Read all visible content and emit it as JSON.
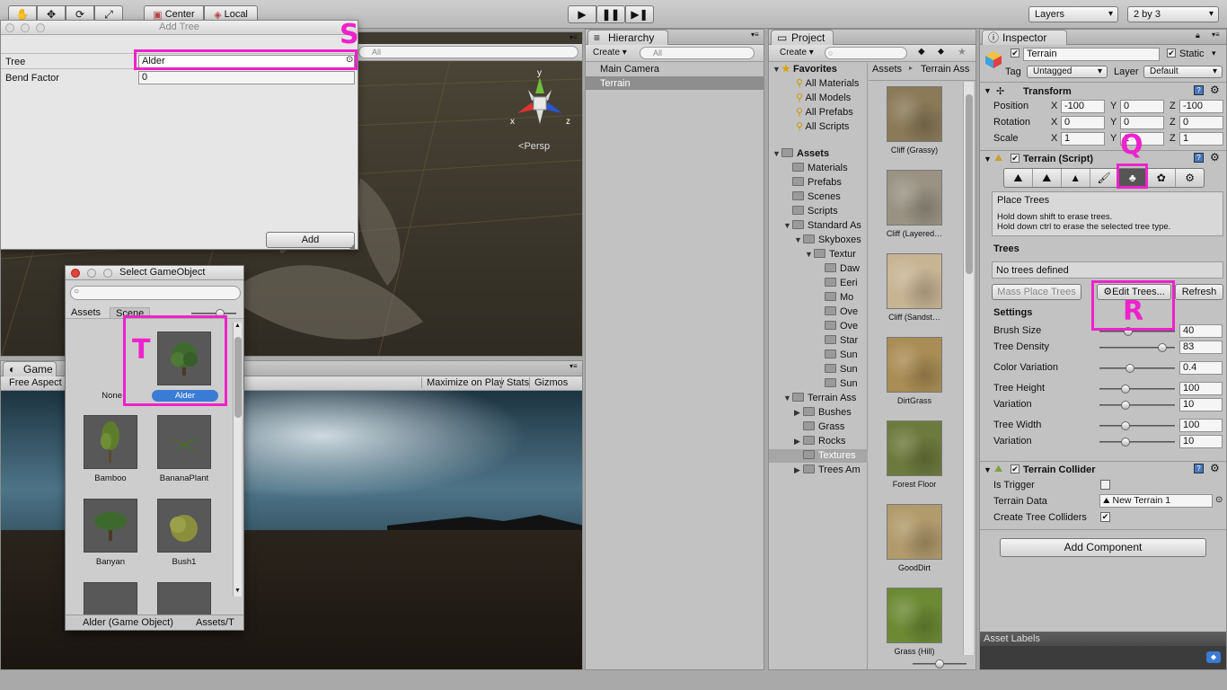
{
  "toolbar": {
    "center_label": "Center",
    "local_label": "Local",
    "layers_label": "Layers",
    "layout_label": "2 by 3"
  },
  "add_tree": {
    "title": "Add Tree",
    "tree_label": "Tree",
    "tree_value": "Alder",
    "bend_label": "Bend Factor",
    "bend_value": "0",
    "add_button": "Add"
  },
  "scene": {
    "search_placeholder": "All",
    "gizmo_y": "y",
    "gizmo_x": "x",
    "gizmo_z": "z",
    "persp_label": "Persp"
  },
  "game": {
    "tab_label": "Game",
    "aspect_label": "Free Aspect",
    "maximize_label": "Maximize on Play",
    "stats_label": "Stats",
    "gizmos_label": "Gizmos"
  },
  "select_go": {
    "title": "Select GameObject",
    "tab_assets": "Assets",
    "tab_scene": "Scene",
    "items": [
      {
        "label": "None"
      },
      {
        "label": "Alder"
      },
      {
        "label": "Bamboo"
      },
      {
        "label": "BananaPlant"
      },
      {
        "label": "Banyan"
      },
      {
        "label": "Bush1"
      }
    ],
    "status_left": "Alder (Game Object)",
    "status_right": "Assets/T"
  },
  "hierarchy": {
    "tab_label": "Hierarchy",
    "create_label": "Create",
    "search_placeholder": "All",
    "items": [
      "Main Camera",
      "Terrain"
    ]
  },
  "project": {
    "tab_label": "Project",
    "create_label": "Create",
    "favorites_label": "Favorites",
    "favorites": [
      "All Materials",
      "All Models",
      "All Prefabs",
      "All Scripts"
    ],
    "assets_label": "Assets",
    "tree": [
      {
        "label": "Materials",
        "indent": 1
      },
      {
        "label": "Prefabs",
        "indent": 1
      },
      {
        "label": "Scenes",
        "indent": 1
      },
      {
        "label": "Scripts",
        "indent": 1
      },
      {
        "label": "Standard As",
        "indent": 1,
        "arrow": "open"
      },
      {
        "label": "Skyboxes",
        "indent": 2,
        "arrow": "open"
      },
      {
        "label": "Textur",
        "indent": 3,
        "arrow": "open"
      },
      {
        "label": "Daw",
        "indent": 4
      },
      {
        "label": "Eeri",
        "indent": 4
      },
      {
        "label": "Mo",
        "indent": 4
      },
      {
        "label": "Ove",
        "indent": 4
      },
      {
        "label": "Ove",
        "indent": 4
      },
      {
        "label": "Star",
        "indent": 4
      },
      {
        "label": "Sun",
        "indent": 4
      },
      {
        "label": "Sun",
        "indent": 4
      },
      {
        "label": "Sun",
        "indent": 4
      },
      {
        "label": "Terrain Ass",
        "indent": 1,
        "arrow": "open"
      },
      {
        "label": "Bushes",
        "indent": 2,
        "arrow": "closed"
      },
      {
        "label": "Grass",
        "indent": 2
      },
      {
        "label": "Rocks",
        "indent": 2,
        "arrow": "closed"
      },
      {
        "label": "Textures",
        "indent": 2,
        "selected": true
      },
      {
        "label": "Trees Am",
        "indent": 2,
        "arrow": "closed"
      }
    ],
    "breadcrumb_root": "Assets",
    "breadcrumb_sep": "▸",
    "breadcrumb_current": "Terrain Ass",
    "textures": [
      {
        "label": "Cliff (Grassy)",
        "color": "#8a7a58"
      },
      {
        "label": "Cliff (Layered…",
        "color": "#9a9384"
      },
      {
        "label": "Cliff (Sandst…",
        "color": "#c7b493"
      },
      {
        "label": "DirtGrass",
        "color": "#a98d55"
      },
      {
        "label": "Forest Floor",
        "color": "#6d7a3d"
      },
      {
        "label": "GoodDirt",
        "color": "#b19a6c"
      },
      {
        "label": "Grass (Hill)",
        "color": "#6c8a34"
      }
    ]
  },
  "inspector": {
    "tab_label": "Inspector",
    "object_name": "Terrain",
    "static_label": "Static",
    "tag_label": "Tag",
    "tag_value": "Untagged",
    "layer_label": "Layer",
    "layer_value": "Default",
    "transform_label": "Transform",
    "position_label": "Position",
    "rotation_label": "Rotation",
    "scale_label": "Scale",
    "axis_x": "X",
    "axis_y": "Y",
    "axis_z": "Z",
    "position": [
      "-100",
      "0",
      "-100"
    ],
    "rotation": [
      "0",
      "0",
      "0"
    ],
    "scale": [
      "1",
      "1",
      "1"
    ],
    "terrain_script_label": "Terrain (Script)",
    "place_trees_title": "Place Trees",
    "place_trees_help1": "Hold down shift to erase trees.",
    "place_trees_help2": "Hold down ctrl to erase the selected tree type.",
    "trees_heading": "Trees",
    "no_trees": "No trees defined",
    "mass_place_button": "Mass Place Trees",
    "edit_trees_button": "Edit Trees...",
    "refresh_button": "Refresh",
    "settings_heading": "Settings",
    "settings": [
      {
        "label": "Brush Size",
        "value": "40",
        "level": 0.38
      },
      {
        "label": "Tree Density",
        "value": "83",
        "level": 0.83
      },
      {
        "label": "Color Variation",
        "value": "0.4",
        "level": 0.4
      },
      {
        "label": "Tree Height",
        "value": "100",
        "level": 0.35
      },
      {
        "label": "Variation",
        "value": "10",
        "level": 0.35
      },
      {
        "label": "Tree Width",
        "value": "100",
        "level": 0.35
      },
      {
        "label": "Variation",
        "value": "10",
        "level": 0.35
      }
    ],
    "collider_label": "Terrain Collider",
    "is_trigger_label": "Is Trigger",
    "terrain_data_label": "Terrain Data",
    "terrain_data_value": "New Terrain 1",
    "create_colliders_label": "Create Tree Colliders",
    "add_component_button": "Add Component",
    "asset_labels": "Asset Labels"
  },
  "annotations": {
    "s": "S",
    "q": "Q",
    "r": "R",
    "t": "T"
  },
  "colors": {
    "highlight": "#ee22cc",
    "selection": "#3a7bd5"
  }
}
